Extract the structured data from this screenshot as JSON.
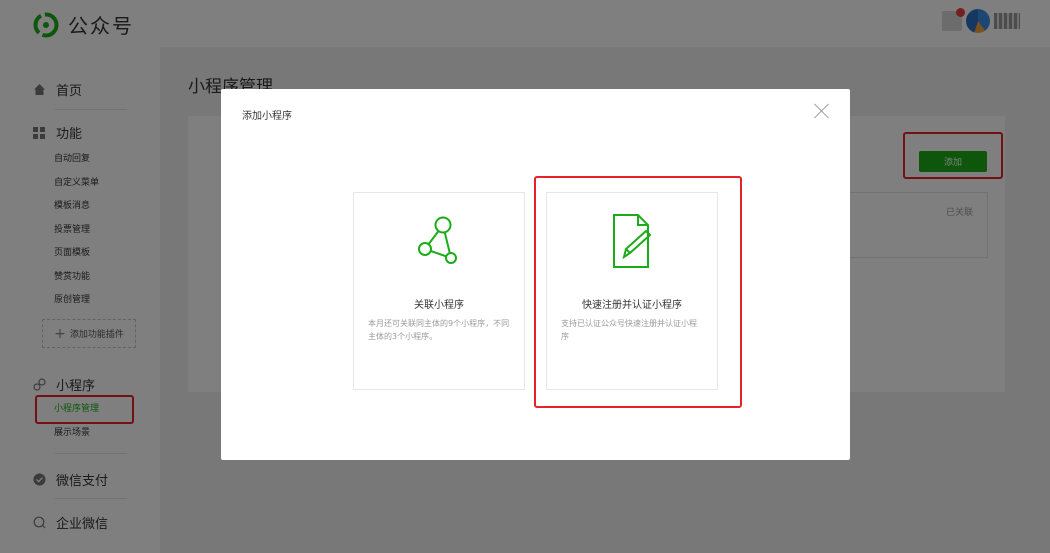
{
  "app": {
    "title": "公众号"
  },
  "sidebar": {
    "home": "首页",
    "features": {
      "label": "功能",
      "items": [
        "自动回复",
        "自定义菜单",
        "模板消息",
        "投票管理",
        "页面模板",
        "赞赏功能",
        "原创管理"
      ],
      "add_plugin": "添加功能插件"
    },
    "mini_program": {
      "label": "小程序",
      "items": [
        "小程序管理",
        "展示场景"
      ],
      "active": "小程序管理"
    },
    "wechat_pay": "微信支付",
    "work_wechat": "企业微信"
  },
  "main": {
    "page_title": "小程序管理",
    "add_button": "添加",
    "linked_status": "已关联"
  },
  "modal": {
    "title": "添加小程序",
    "options": [
      {
        "title": "关联小程序",
        "desc": "本月还可关联同主体的9个小程序，不同主体的3个小程序。",
        "icon": "share-nodes-icon"
      },
      {
        "title": "快速注册并认证小程序",
        "desc": "支持已认证公众号快速注册并认证小程序",
        "icon": "document-pen-icon"
      }
    ]
  },
  "colors": {
    "brand_green": "#1aad19",
    "highlight_red": "#e6212a"
  }
}
